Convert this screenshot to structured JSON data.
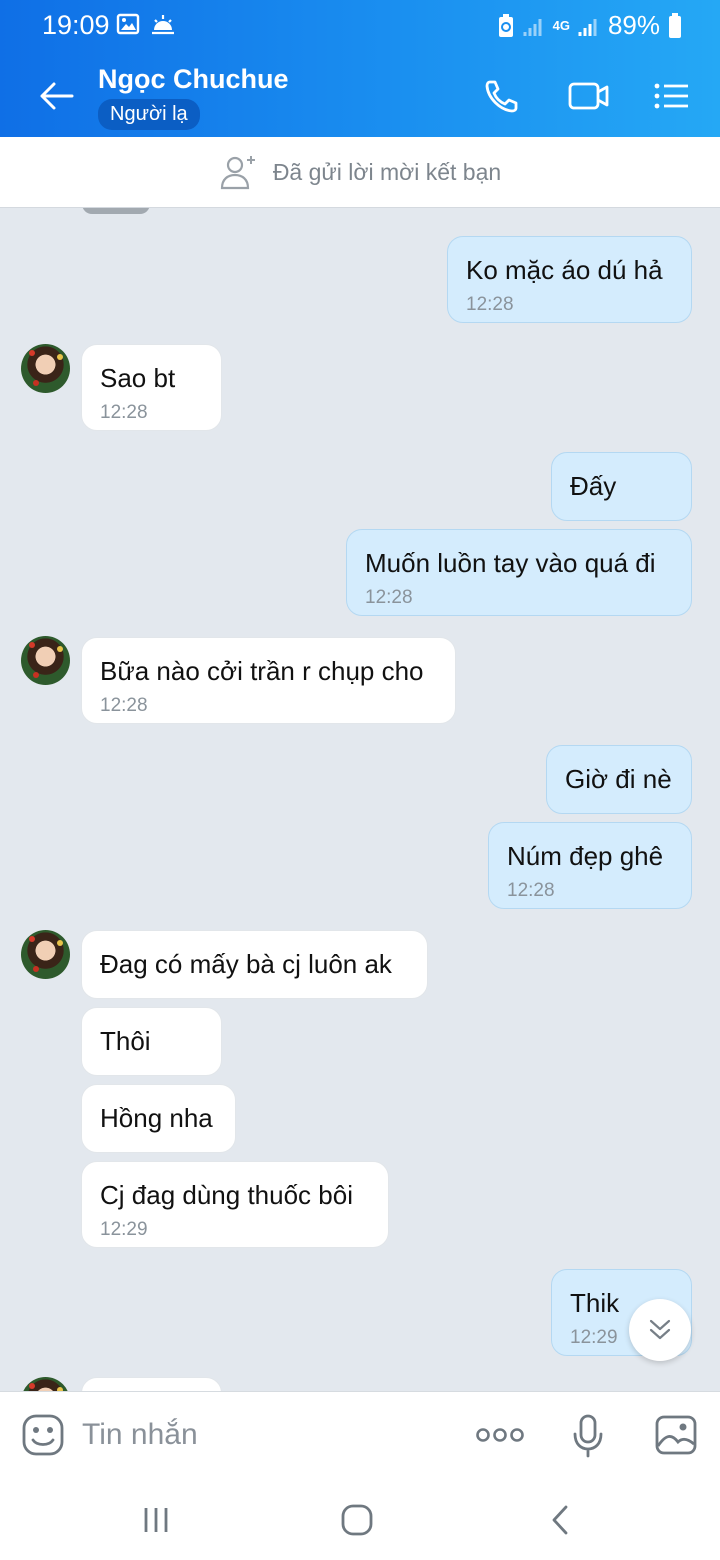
{
  "status_bar": {
    "time": "19:09",
    "network": "4G",
    "battery": "89%"
  },
  "header": {
    "contact_name": "Ngọc Chuchue",
    "badge": "Người lạ"
  },
  "friend_request": {
    "text": "Đã gửi lời mời kết bạn"
  },
  "messages": [
    {
      "side": "me",
      "text": "Ko mặc áo dú hả",
      "time": "12:28"
    },
    {
      "side": "them",
      "text": "Sao bt",
      "time": "12:28"
    },
    {
      "side": "me",
      "text": "Đấy"
    },
    {
      "side": "me",
      "text": "Muốn luồn tay vào quá đi",
      "time": "12:28"
    },
    {
      "side": "them",
      "text": "Bữa nào cởi trần r chụp cho",
      "time": "12:28"
    },
    {
      "side": "me",
      "text": "Giờ đi nè"
    },
    {
      "side": "me",
      "text": "Núm đẹp ghê",
      "time": "12:28"
    },
    {
      "side": "them",
      "text": "Đag có mấy bà cj luôn ak"
    },
    {
      "side": "them",
      "text": "Thôi"
    },
    {
      "side": "them",
      "text": "Hồng nha"
    },
    {
      "side": "them",
      "text": "Cj đag dùng thuốc bôi",
      "time": "12:29"
    },
    {
      "side": "me",
      "text": "Thik",
      "time": "12:29"
    }
  ],
  "input": {
    "placeholder": "Tin nhắn"
  },
  "icons": {
    "back": "arrow-left-icon",
    "call": "phone-icon",
    "video": "video-camera-icon",
    "menu": "list-menu-icon",
    "add_friend": "add-user-icon",
    "emoji": "emoji-icon",
    "more": "more-dots-icon",
    "mic": "microphone-icon",
    "gallery": "image-gallery-icon",
    "scroll": "double-chevron-down-icon"
  },
  "colors": {
    "header": "#1a8ff0",
    "my_bubble": "#d4ecfd",
    "their_bubble": "#ffffff",
    "chat_bg": "#e3e8ee"
  }
}
